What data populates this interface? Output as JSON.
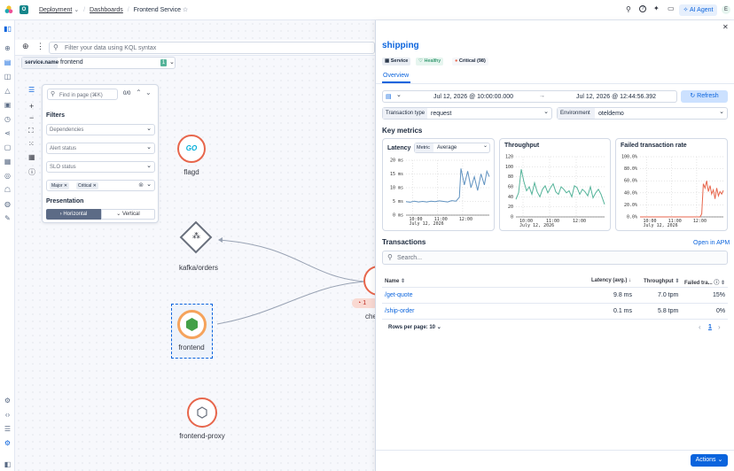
{
  "topbar": {
    "space_letter": "O",
    "breadcrumbs": [
      "Deployment",
      "Dashboards",
      "Frontend Service"
    ],
    "ai_agent": "AI Agent",
    "user_initial": "E"
  },
  "query": {
    "placeholder": "Filter your data using KQL syntax"
  },
  "control": {
    "field": "service.name",
    "value": "frontend",
    "count": "1"
  },
  "map_panel": {
    "find_placeholder": "Find in page (⌘K)",
    "find_count": "0/0",
    "filters_title": "Filters",
    "dependencies": "Dependencies",
    "alert_status": "Alert status",
    "slo_status": "SLO status",
    "pills": [
      "Major",
      "Critical"
    ],
    "presentation_title": "Presentation",
    "horizontal": "Horizontal",
    "vertical": "Vertical"
  },
  "nodes": {
    "flagd": "flagd",
    "kafka": "kafka/orders",
    "frontend": "frontend",
    "proxy": "frontend-proxy",
    "checkout_partial": "che",
    "checkout_badge": "1",
    "go_label": "GO"
  },
  "flyout": {
    "title": "shipping",
    "badges": {
      "service": "Service",
      "healthy": "Healthy",
      "critical": "Critical (98)"
    },
    "tab": "Overview",
    "time_start": "Jul 12, 2026 @ 10:00:00.000",
    "time_end": "Jul 12, 2026 @ 12:44:56.392",
    "refresh": "Refresh",
    "transaction_type_label": "Transaction type",
    "transaction_type_value": "request",
    "environment_label": "Environment",
    "environment_value": "oteldemo",
    "key_metrics": "Key metrics",
    "transactions_title": "Transactions",
    "open_apm": "Open in APM",
    "search_placeholder": "Search...",
    "rows_per_page": "Rows per page: 10",
    "page": "1",
    "actions": "Actions"
  },
  "table": {
    "headers": [
      "Name",
      "Latency (avg.)",
      "Throughput",
      "Failed tra..."
    ],
    "rows": [
      {
        "name": "/get-quote",
        "latency": "9.8 ms",
        "throughput": "7.0 tpm",
        "failed": "15%"
      },
      {
        "name": "/ship-order",
        "latency": "0.1 ms",
        "throughput": "5.8 tpm",
        "failed": "0%"
      }
    ]
  },
  "colors": {
    "accent": "#0b64dd",
    "danger": "#e7664c",
    "success": "#54b399",
    "healthy": "#007e4a",
    "node_ring_red": "#e7664c",
    "node_ring_orange": "#f5a35c"
  },
  "chart_data": [
    {
      "type": "line",
      "title": "Latency",
      "metric_label": "Metric",
      "metric_value": "Average",
      "ylim": [
        0,
        20
      ],
      "y_ticks": [
        "20 ms",
        "15 ms",
        "10 ms",
        "5 ms",
        "0 ms"
      ],
      "x_ticks": [
        "10:00",
        "11:00",
        "12:00"
      ],
      "x_sub": "July 12, 2026",
      "color": "#6092c0",
      "series": [
        {
          "x": [
            0,
            0.05,
            0.1,
            0.15,
            0.2,
            0.25,
            0.3,
            0.35,
            0.4,
            0.45,
            0.5,
            0.55,
            0.6,
            0.64,
            0.66,
            0.7,
            0.74,
            0.78,
            0.82,
            0.86,
            0.9,
            0.94,
            0.97,
            1.0
          ],
          "y": [
            4.9,
            4.7,
            5.1,
            4.8,
            5.0,
            4.8,
            5.1,
            4.9,
            5.2,
            5.0,
            4.8,
            5.3,
            5.1,
            6.5,
            17,
            11,
            16,
            10,
            14,
            9,
            15,
            11,
            16,
            14
          ]
        }
      ]
    },
    {
      "type": "line",
      "title": "Throughput",
      "ylim": [
        0,
        120
      ],
      "y_ticks": [
        "120",
        "100",
        "80",
        "60",
        "40",
        "20",
        "0"
      ],
      "x_ticks": [
        "10:00",
        "11:00",
        "12:00"
      ],
      "x_sub": "July 12, 2026",
      "color": "#54b399",
      "series": [
        {
          "x": [
            0,
            0.03,
            0.06,
            0.09,
            0.12,
            0.15,
            0.18,
            0.21,
            0.24,
            0.27,
            0.3,
            0.33,
            0.36,
            0.39,
            0.42,
            0.45,
            0.48,
            0.51,
            0.54,
            0.57,
            0.6,
            0.63,
            0.66,
            0.69,
            0.72,
            0.75,
            0.78,
            0.81,
            0.84,
            0.87,
            0.9,
            0.93,
            0.96,
            1.0
          ],
          "y": [
            35,
            48,
            95,
            70,
            52,
            60,
            45,
            68,
            50,
            40,
            55,
            62,
            48,
            58,
            66,
            50,
            45,
            60,
            55,
            48,
            52,
            40,
            62,
            58,
            45,
            55,
            50,
            42,
            60,
            38,
            48,
            55,
            45,
            25
          ]
        }
      ]
    },
    {
      "type": "line",
      "title": "Failed transaction rate",
      "ylim": [
        0,
        100
      ],
      "y_ticks": [
        "100.0%",
        "80.0%",
        "60.0%",
        "40.0%",
        "20.0%",
        "0.0%"
      ],
      "x_ticks": [
        "10:00",
        "11:00",
        "12:00"
      ],
      "x_sub": "July 12, 2026",
      "color": "#e7664c",
      "series": [
        {
          "x": [
            0.0,
            0.72,
            0.74,
            0.76,
            0.78,
            0.8,
            0.82,
            0.84,
            0.86,
            0.88,
            0.9,
            0.92,
            0.94,
            0.96,
            0.98,
            1.0
          ],
          "y": [
            0,
            0,
            5,
            55,
            48,
            60,
            42,
            52,
            38,
            45,
            30,
            48,
            35,
            42,
            38,
            44
          ]
        }
      ]
    }
  ]
}
